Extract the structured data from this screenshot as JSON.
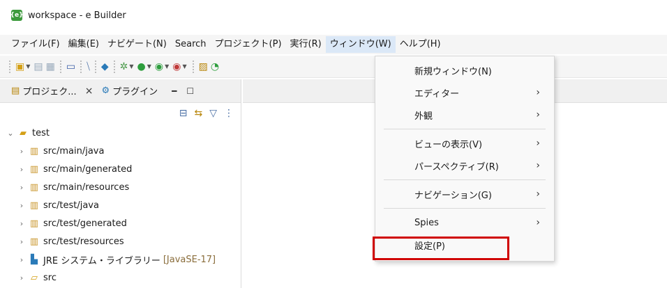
{
  "window": {
    "title": "workspace - e Builder",
    "app_icon": "e-builder-icon"
  },
  "menubar": {
    "items": [
      "ファイル(F)",
      "編集(E)",
      "ナビゲート(N)",
      "Search",
      "プロジェクト(P)",
      "実行(R)",
      "ウィンドウ(W)",
      "ヘルプ(H)"
    ],
    "active_index": 6
  },
  "panel": {
    "tabs": [
      {
        "label": "プロジェク...",
        "icon": "package-explorer-icon"
      },
      {
        "label": "プラグイン",
        "icon": "plugins-icon"
      }
    ]
  },
  "tree": {
    "root": "test",
    "children": [
      "src/main/java",
      "src/main/generated",
      "src/main/resources",
      "src/test/java",
      "src/test/generated",
      "src/test/resources"
    ],
    "jre": {
      "label": "JRE システム・ライブラリー",
      "tag": "[JavaSE-17]"
    },
    "src_folder": "src"
  },
  "dropdown": {
    "items": [
      {
        "label": "新規ウィンドウ(N)",
        "submenu": false
      },
      {
        "label": "エディター",
        "submenu": true
      },
      {
        "label": "外観",
        "submenu": true
      },
      {
        "label": "ビューの表示(V)",
        "submenu": true
      },
      {
        "label": "パースペクティブ(R)",
        "submenu": true
      },
      {
        "label": "ナビゲーション(G)",
        "submenu": true
      },
      {
        "label": "Spies",
        "submenu": true
      },
      {
        "label": "設定(P)",
        "submenu": false,
        "highlighted": true
      }
    ],
    "highlight_color": "#d00000"
  }
}
